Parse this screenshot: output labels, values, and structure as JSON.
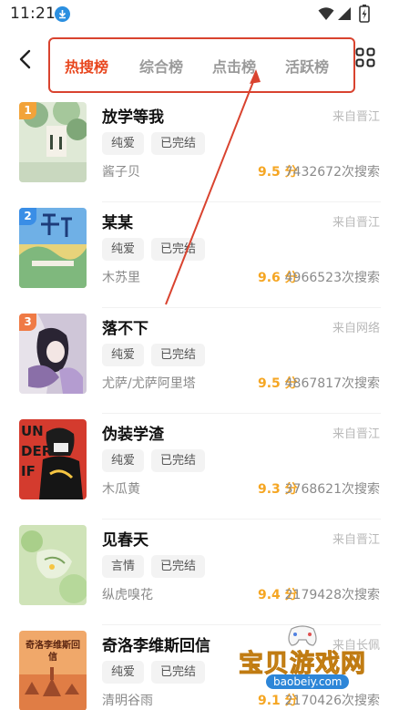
{
  "status_bar": {
    "time": "11:21",
    "download_icon": "download-icon",
    "wifi_icon": "wifi-icon",
    "signal_icon": "signal-icon",
    "battery_icon": "battery-charging-icon"
  },
  "header": {
    "back_icon": "chevron-left-icon",
    "grid_icon": "grid-icon",
    "tabs": [
      {
        "label": "热搜榜",
        "active": true
      },
      {
        "label": "综合榜",
        "active": false
      },
      {
        "label": "点击榜",
        "active": false
      },
      {
        "label": "活跃榜",
        "active": false
      }
    ],
    "highlight_color": "#d9432f",
    "active_color": "#e8471f"
  },
  "books": [
    {
      "rank": "1",
      "title": "放学等我",
      "source": "来自晋江",
      "tags": [
        "纯爱",
        "已完结"
      ],
      "author": "酱子贝",
      "score": "9.5 分",
      "searches": "7432672次搜索"
    },
    {
      "rank": "2",
      "title": "某某",
      "source": "来自晋江",
      "tags": [
        "纯爱",
        "已完结"
      ],
      "author": "木苏里",
      "score": "9.6 分",
      "searches": "4966523次搜索"
    },
    {
      "rank": "3",
      "title": "落不下",
      "source": "来自网络",
      "tags": [
        "纯爱",
        "已完结"
      ],
      "author": "尤萨/尤萨阿里塔",
      "score": "9.5 分",
      "searches": "4867817次搜索"
    },
    {
      "rank": "",
      "title": "伪装学渣",
      "source": "来自晋江",
      "tags": [
        "纯爱",
        "已完结"
      ],
      "author": "木瓜黄",
      "score": "9.3 分",
      "searches": "3768621次搜索"
    },
    {
      "rank": "",
      "title": "见春天",
      "source": "来自晋江",
      "tags": [
        "言情",
        "已完结"
      ],
      "author": "纵虎嗅花",
      "score": "9.4 分",
      "searches": "2179428次搜索"
    },
    {
      "rank": "",
      "title": "奇洛李维斯回信",
      "source": "来自长佩",
      "tags": [
        "纯爱",
        "已完结"
      ],
      "author": "清明谷雨",
      "score": "9.1 分",
      "searches": "2170426次搜索"
    }
  ],
  "covers": {
    "book1_cover_text": "",
    "book4_cover_text": "UN DER IF",
    "book6_cover_text": "奇洛李维斯回信"
  },
  "watermark": {
    "text": "宝贝游戏网",
    "url": "baobeiy.com"
  }
}
